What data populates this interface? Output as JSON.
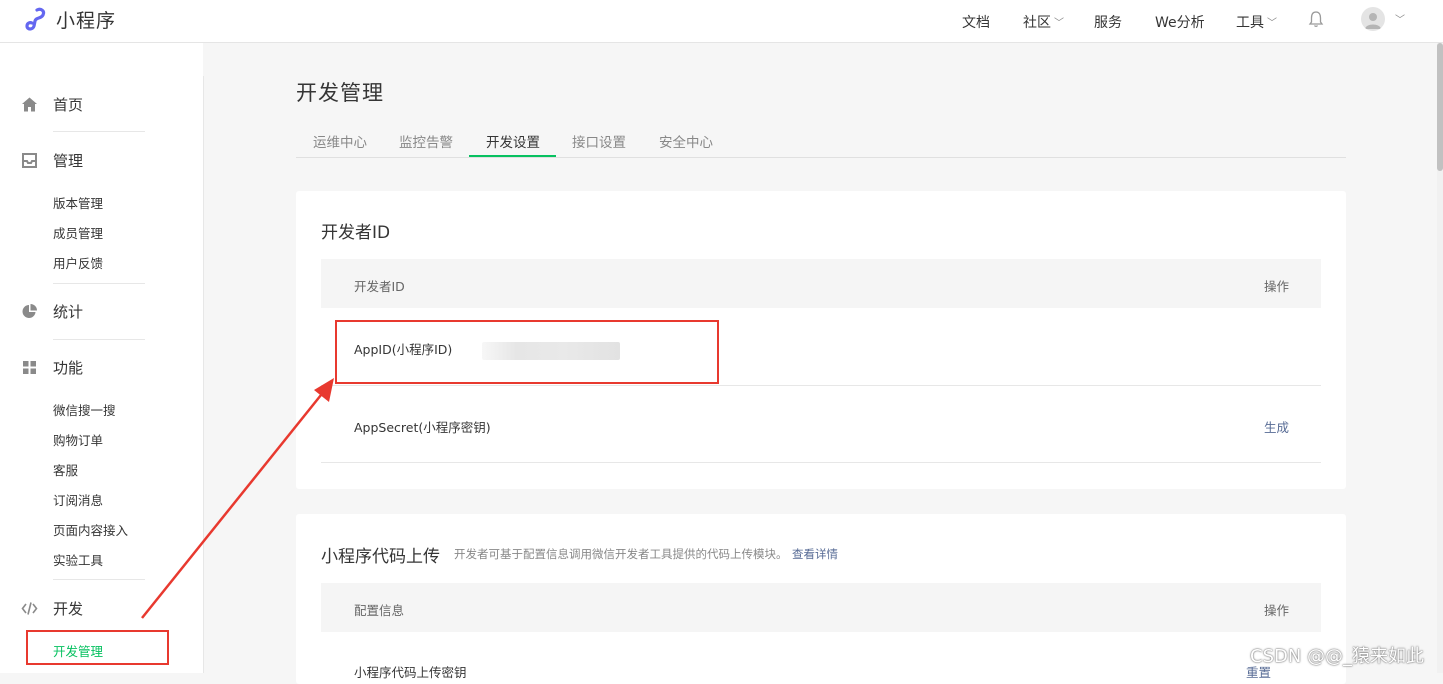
{
  "header": {
    "logo_text": "小程序",
    "nav": [
      {
        "label": "文档",
        "dropdown": false
      },
      {
        "label": "社区",
        "dropdown": true
      },
      {
        "label": "服务",
        "dropdown": false
      },
      {
        "label": "We分析",
        "dropdown": false
      },
      {
        "label": "工具",
        "dropdown": true
      }
    ],
    "icons": [
      "bell-icon",
      "avatar",
      "chevron-down-icon"
    ]
  },
  "sidebar": {
    "sections": [
      {
        "label": "首页",
        "icon": "home-icon"
      },
      {
        "label": "管理",
        "icon": "inbox-icon",
        "items": [
          "版本管理",
          "成员管理",
          "用户反馈"
        ]
      },
      {
        "label": "统计",
        "icon": "pie-chart-icon"
      },
      {
        "label": "功能",
        "icon": "grid-icon",
        "items": [
          "微信搜一搜",
          "购物订单",
          "客服",
          "订阅消息",
          "页面内容接入",
          "实验工具"
        ]
      },
      {
        "label": "开发",
        "icon": "code-icon",
        "items": [
          "开发管理"
        ]
      }
    ],
    "active_item": "开发管理"
  },
  "main": {
    "title": "开发管理",
    "tabs": [
      "运维中心",
      "监控告警",
      "开发设置",
      "接口设置",
      "安全中心"
    ],
    "active_tab": "开发设置",
    "dev_id_card": {
      "title": "开发者ID",
      "columns": [
        "开发者ID",
        "操作"
      ],
      "rows": [
        {
          "label": "AppID(小程序ID)",
          "value_redacted": true,
          "action": ""
        },
        {
          "label": "AppSecret(小程序密钥)",
          "action": "生成"
        }
      ]
    },
    "upload_card": {
      "title": "小程序代码上传",
      "description": "开发者可基于配置信息调用微信开发者工具提供的代码上传模块。",
      "link": "查看详情",
      "columns": [
        "配置信息",
        "操作"
      ],
      "rows": [
        {
          "label": "小程序代码上传密钥",
          "action": "重置"
        }
      ]
    }
  },
  "watermark": "CSDN @@_猿来如此",
  "colors": {
    "accent": "#07c160",
    "link": "#576b95",
    "annotation": "#e8392f"
  }
}
